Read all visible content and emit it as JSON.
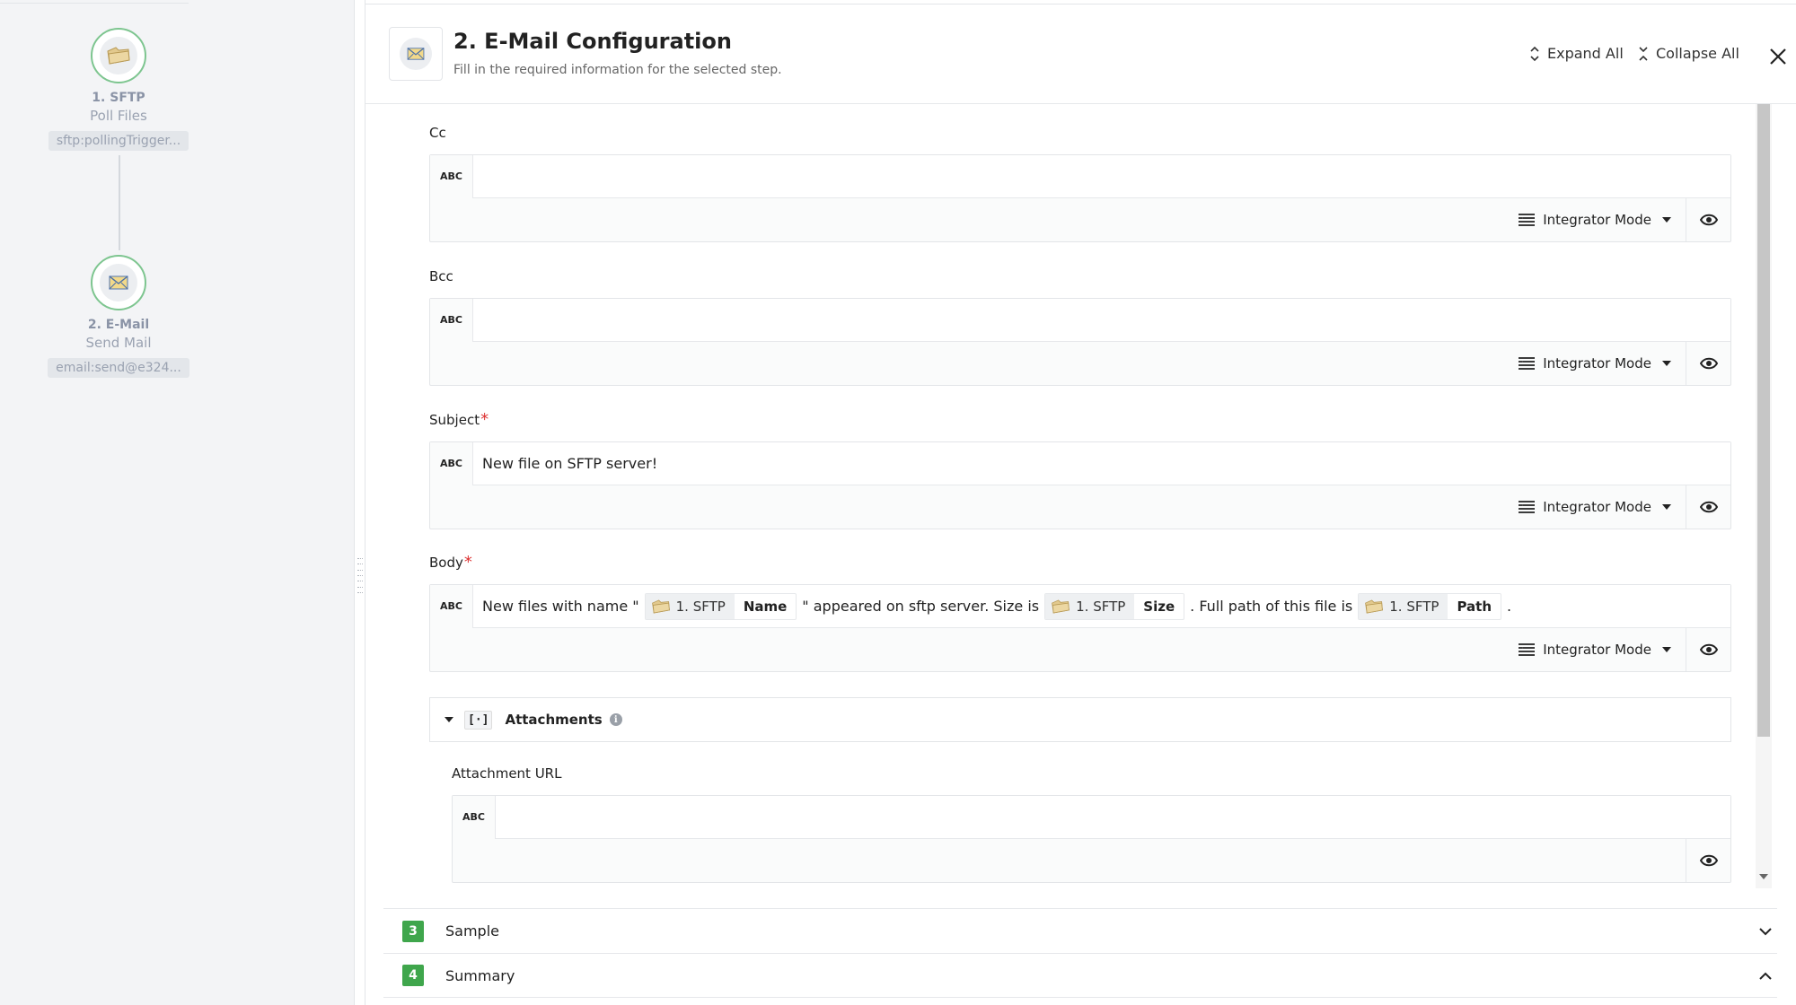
{
  "flow": {
    "nodes": [
      {
        "title": "1. SFTP",
        "subtitle": "Poll Files",
        "pill": "sftp:pollingTrigger..."
      },
      {
        "title": "2. E-Mail",
        "subtitle": "Send Mail",
        "pill": "email:send@e324..."
      }
    ]
  },
  "header": {
    "title": "2. E-Mail Configuration",
    "subtitle": "Fill in the required information for the selected step.",
    "expand_all": "Expand All",
    "collapse_all": "Collapse All"
  },
  "fields": {
    "cc": {
      "label": "Cc",
      "type_badge": "ABC",
      "value": "",
      "mode": "Integrator Mode"
    },
    "bcc": {
      "label": "Bcc",
      "type_badge": "ABC",
      "value": "",
      "mode": "Integrator Mode"
    },
    "subject": {
      "label": "Subject",
      "required_mark": "*",
      "type_badge": "ABC",
      "value": "New file on SFTP server!",
      "mode": "Integrator Mode"
    },
    "body": {
      "label": "Body",
      "required_mark": "*",
      "type_badge": "ABC",
      "mode": "Integrator Mode",
      "text_1": "New files with name \"",
      "ref_1": {
        "source": "1. SFTP",
        "key": "Name"
      },
      "text_2": "\" appeared on sftp server. Size is",
      "ref_2": {
        "source": "1. SFTP",
        "key": "Size"
      },
      "text_3": ". Full path of this file is",
      "ref_3": {
        "source": "1. SFTP",
        "key": "Path"
      },
      "text_4": "."
    },
    "attachments": {
      "array_icon": "[·]",
      "title": "Attachments",
      "info": "i",
      "attachment_url": {
        "label": "Attachment URL",
        "type_badge": "ABC",
        "value": ""
      }
    }
  },
  "sections": [
    {
      "number": "3",
      "label": "Sample",
      "state": "collapsed"
    },
    {
      "number": "4",
      "label": "Summary",
      "state": "expanded"
    }
  ],
  "icons": {
    "sftp": "folder-icon",
    "email": "envelope-icon",
    "mode": "list-lines-icon",
    "preview": "eye-icon"
  },
  "colors": {
    "accent_green": "#3fa64c",
    "node_border": "#7dc58f",
    "required": "#dd3333"
  }
}
